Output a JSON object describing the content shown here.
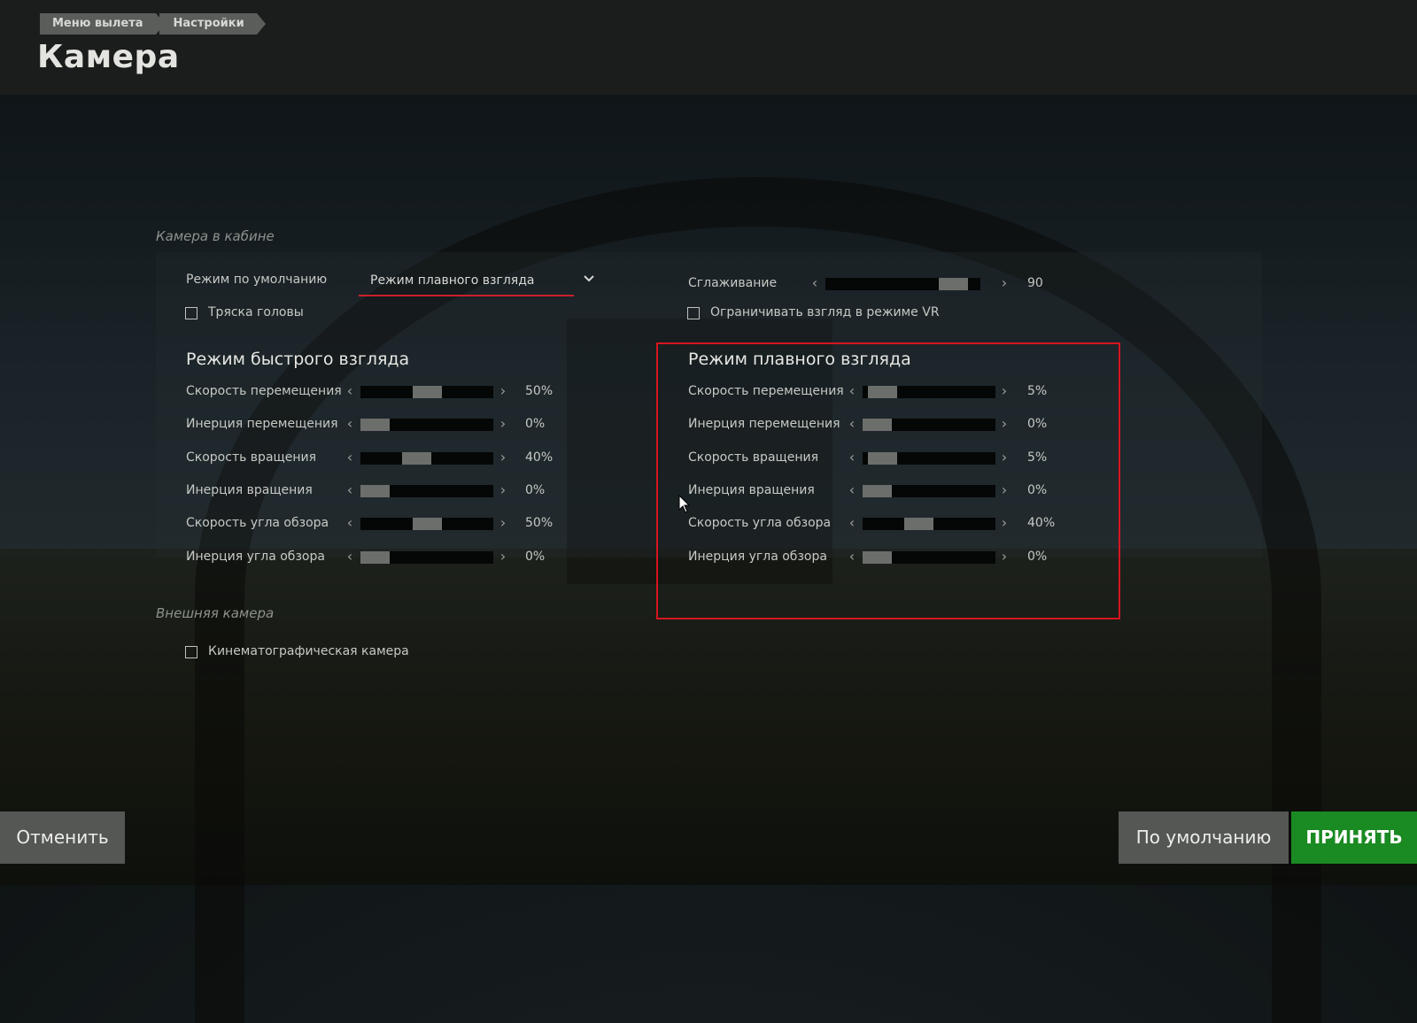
{
  "breadcrumb": [
    "Меню вылета",
    "Настройки"
  ],
  "title": "Камера",
  "cockpit": {
    "section_label": "Камера в кабине",
    "default_mode_label": "Режим по умолчанию",
    "default_mode_value": "Режим плавного взгляда",
    "head_shake_label": "Тряска головы",
    "head_shake_checked": false,
    "smoothing_label": "Сглаживание",
    "smoothing_value": "90",
    "smoothing_fraction": 0.9,
    "vr_limit_label": "Ограничивать взгляд в режиме VR",
    "vr_limit_checked": false
  },
  "fast_look": {
    "heading": "Режим быстрого взгляда",
    "rows": [
      {
        "label": "Скорость перемещения",
        "value": "50%",
        "fraction": 0.5
      },
      {
        "label": "Инерция перемещения",
        "value": "0%",
        "fraction": 0.0
      },
      {
        "label": "Скорость вращения",
        "value": "40%",
        "fraction": 0.4
      },
      {
        "label": "Инерция вращения",
        "value": "0%",
        "fraction": 0.0
      },
      {
        "label": "Скорость угла обзора",
        "value": "50%",
        "fraction": 0.5
      },
      {
        "label": "Инерция угла обзора",
        "value": "0%",
        "fraction": 0.0
      }
    ]
  },
  "smooth_look": {
    "heading": "Режим плавного взгляда",
    "rows": [
      {
        "label": "Скорость перемещения",
        "value": "5%",
        "fraction": 0.05
      },
      {
        "label": "Инерция перемещения",
        "value": "0%",
        "fraction": 0.0
      },
      {
        "label": "Скорость вращения",
        "value": "5%",
        "fraction": 0.05
      },
      {
        "label": "Инерция вращения",
        "value": "0%",
        "fraction": 0.0
      },
      {
        "label": "Скорость угла обзора",
        "value": "40%",
        "fraction": 0.4
      },
      {
        "label": "Инерция угла обзора",
        "value": "0%",
        "fraction": 0.0
      }
    ]
  },
  "external": {
    "section_label": "Внешняя камера",
    "cinematic_label": "Кинематографическая камера",
    "cinematic_checked": false
  },
  "buttons": {
    "cancel": "Отменить",
    "default": "По умолчанию",
    "accept": "ПРИНЯТЬ"
  },
  "icons": {
    "arrow_left": "‹",
    "arrow_right": "›"
  },
  "colors": {
    "accent_red": "#c8202a",
    "accept_green": "#1a8a22",
    "highlight_red": "#d6151f"
  }
}
